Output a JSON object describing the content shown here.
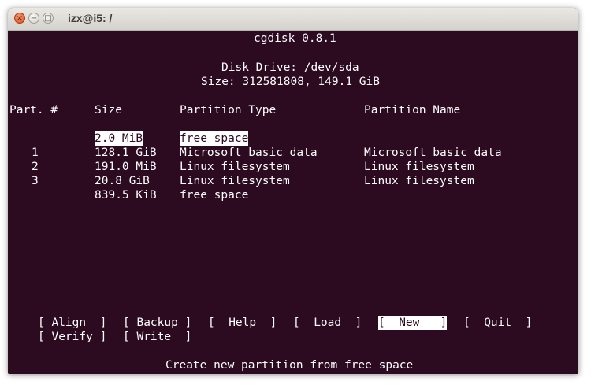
{
  "window": {
    "title": "izx@i5: /",
    "controls": {
      "close": "×",
      "minimize": "−",
      "maximize": "□"
    }
  },
  "terminal": {
    "app_title": "cgdisk 0.8.1",
    "disk_line": "Disk Drive: /dev/sda",
    "size_line": "Size: 312581808, 149.1 GiB",
    "headers": {
      "part": "Part. #",
      "size": "Size",
      "type": "Partition Type",
      "name": "Partition Name"
    },
    "separator": "------------------------------------------------------------------------------------",
    "rows": [
      {
        "part": "",
        "size": "2.0 MiB",
        "type": "free space",
        "name": "",
        "selected": true
      },
      {
        "part": "1",
        "size": "128.1 GiB",
        "type": "Microsoft basic data",
        "name": "Microsoft basic data",
        "selected": false
      },
      {
        "part": "2",
        "size": "191.0 MiB",
        "type": "Linux filesystem",
        "name": "Linux filesystem",
        "selected": false
      },
      {
        "part": "3",
        "size": "20.8 GiB",
        "type": "Linux filesystem",
        "name": "Linux filesystem",
        "selected": false
      },
      {
        "part": "",
        "size": "839.5 KiB",
        "type": "free space",
        "name": "",
        "selected": false
      }
    ],
    "menu": {
      "align": "[ Align  ]",
      "backup": "[ Backup ]",
      "help": "[  Help  ]",
      "load": "[  Load  ]",
      "new": "[  New   ]",
      "quit": "[  Quit  ]",
      "verify": "[ Verify ]",
      "write": "[ Write  ]",
      "selected": "new"
    },
    "status": "Create new partition from free space"
  },
  "colors": {
    "terminal_bg": "#2c0a1f",
    "terminal_fg": "#ffffff",
    "close_button": "#df4b16"
  }
}
